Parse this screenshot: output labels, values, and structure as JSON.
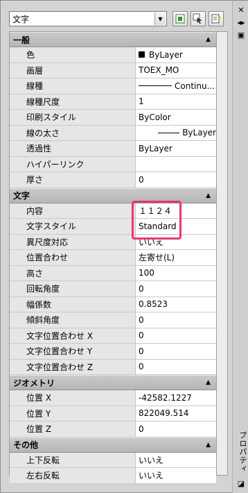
{
  "toolbar": {
    "object_type": "文字"
  },
  "side": {
    "title": "プロパティ"
  },
  "sections": {
    "general": {
      "label": "一般",
      "rows": [
        {
          "name": "色",
          "value": "ByLayer"
        },
        {
          "name": "画層",
          "value": "TOEX_MO"
        },
        {
          "name": "線種",
          "value": "Continu..."
        },
        {
          "name": "線種尺度",
          "value": "1"
        },
        {
          "name": "印刷スタイル",
          "value": "ByColor"
        },
        {
          "name": "線の太さ",
          "value": "ByLayer"
        },
        {
          "name": "透過性",
          "value": "ByLayer"
        },
        {
          "name": "ハイパーリンク",
          "value": ""
        },
        {
          "name": "厚さ",
          "value": "0"
        }
      ]
    },
    "text": {
      "label": "文字",
      "rows": [
        {
          "name": "内容",
          "value": "１１２４"
        },
        {
          "name": "文字スタイル",
          "value": "Standard"
        },
        {
          "name": "異尺度対応",
          "value": "いいえ"
        },
        {
          "name": "位置合わせ",
          "value": "左寄せ(L)"
        },
        {
          "name": "高さ",
          "value": "100"
        },
        {
          "name": "回転角度",
          "value": "0"
        },
        {
          "name": "幅係数",
          "value": "0.8523"
        },
        {
          "name": "傾斜角度",
          "value": "0"
        },
        {
          "name": "文字位置合わせ X",
          "value": "0"
        },
        {
          "name": "文字位置合わせ Y",
          "value": "0"
        },
        {
          "name": "文字位置合わせ Z",
          "value": "0"
        }
      ]
    },
    "geometry": {
      "label": "ジオメトリ",
      "rows": [
        {
          "name": "位置 X",
          "value": "-42582.1227"
        },
        {
          "name": "位置 Y",
          "value": "822049.514"
        },
        {
          "name": "位置 Z",
          "value": "0"
        }
      ]
    },
    "misc": {
      "label": "その他",
      "rows": [
        {
          "name": "上下反転",
          "value": "いいえ"
        },
        {
          "name": "左右反転",
          "value": "いいえ"
        }
      ]
    }
  },
  "colors": {
    "highlight": "#e8357a",
    "section_bg": "#bcbcbc"
  }
}
